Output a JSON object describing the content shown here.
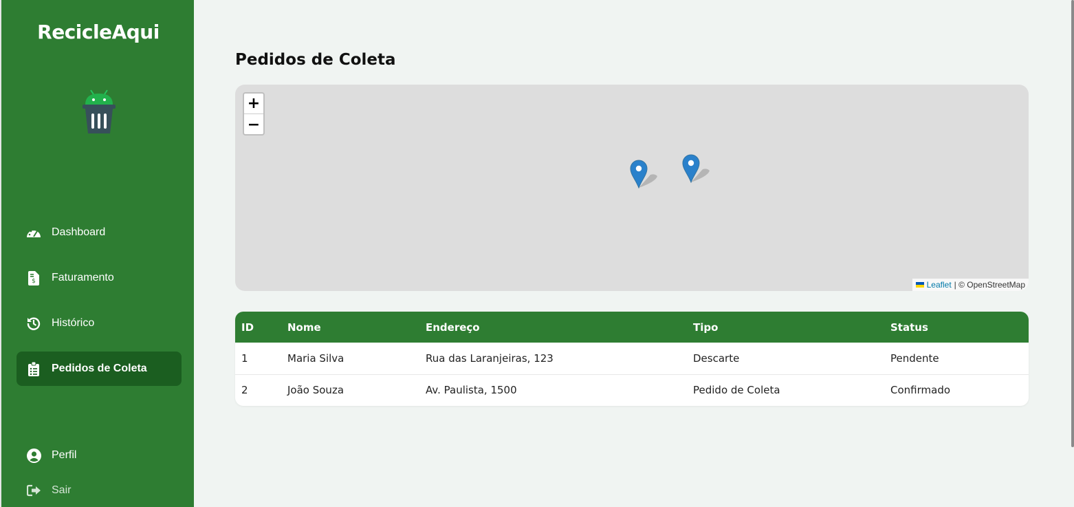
{
  "app": {
    "name": "RecicleAqui"
  },
  "sidebar": {
    "items": [
      {
        "label": "Dashboard",
        "icon": "dashboard-gauge-icon"
      },
      {
        "label": "Faturamento",
        "icon": "invoice-dollar-icon"
      },
      {
        "label": "Histórico",
        "icon": "history-icon"
      },
      {
        "label": "Pedidos de Coleta",
        "icon": "clipboard-list-icon",
        "active": true
      }
    ],
    "bottom": [
      {
        "label": "Perfil",
        "icon": "user-circle-icon"
      },
      {
        "label": "Sair",
        "icon": "sign-out-icon"
      }
    ]
  },
  "page": {
    "title": "Pedidos de Coleta"
  },
  "map": {
    "zoom_in": "+",
    "zoom_out": "−",
    "attribution_leaflet": "Leaflet",
    "attribution_rest": "| © OpenStreetMap",
    "marker_count": 2
  },
  "table": {
    "headers": [
      "ID",
      "Nome",
      "Endereço",
      "Tipo",
      "Status"
    ],
    "rows": [
      [
        "1",
        "Maria Silva",
        "Rua das Laranjeiras, 123",
        "Descarte",
        "Pendente"
      ],
      [
        "2",
        "João Souza",
        "Av. Paulista, 1500",
        "Pedido de Coleta",
        "Confirmado"
      ]
    ]
  },
  "colors": {
    "primary": "#2e7d32",
    "active": "#1b5e20",
    "marker": "#2a81cb",
    "background": "#f0f4f2"
  }
}
